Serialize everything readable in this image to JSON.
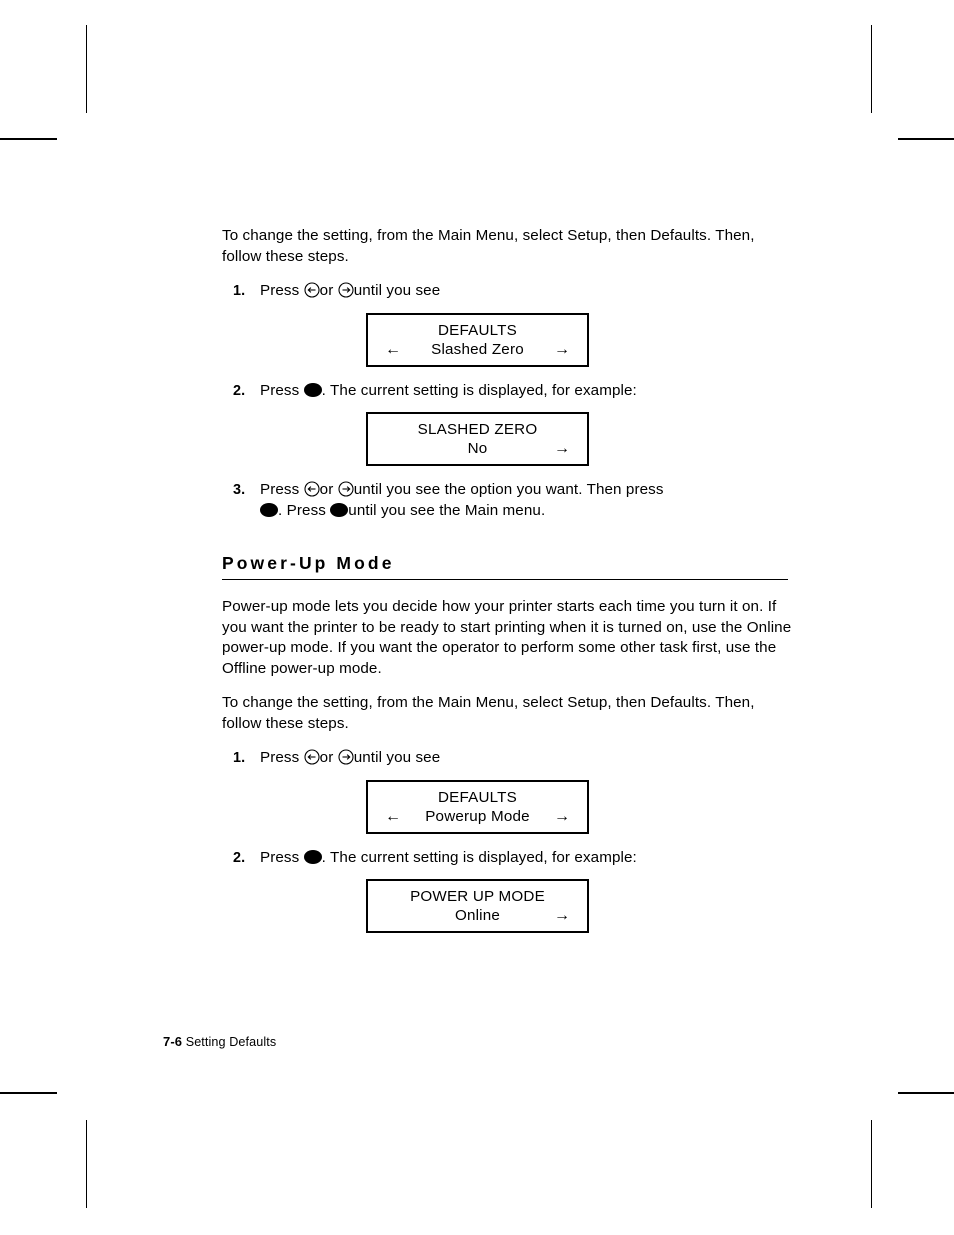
{
  "page": {
    "footer_page_number": "7-6",
    "footer_section": "Setting Defaults"
  },
  "intro_section": {
    "intro_paragraph": "To change the setting, from the Main Menu, select Setup, then Defaults.  Then, follow these steps.",
    "steps": [
      {
        "number": "1.",
        "text_before": "Press",
        "icon_left": "left-arrow-button-icon",
        "text_middle": "or",
        "icon_right": "right-arrow-button-icon",
        "text_after": "until you see"
      },
      {
        "number": "2.",
        "text_before": "Press",
        "icon_enter": "enter-button-icon",
        "text_after": ".  The current setting is displayed, for example:"
      },
      {
        "number": "3.",
        "text_before": "Press",
        "icon_left": "left-arrow-button-icon",
        "text_middle": "or",
        "icon_right": "right-arrow-button-icon",
        "text_after": "until you see the option you want.  Then press",
        "line2_icon_a": "enter-button-icon",
        "line2_text_a": ".  Press",
        "line2_icon_b": "enter-button-icon",
        "line2_text_b": "until you see the Main menu."
      }
    ],
    "lcd_menu": {
      "line1": "DEFAULTS",
      "line2": "Slashed Zero",
      "arrow_left": "←",
      "arrow_right": "→",
      "show_left_arrow": true,
      "show_right_arrow": true
    },
    "lcd_setting": {
      "line1": "SLASHED ZERO",
      "line2": "No",
      "arrow_left": "←",
      "arrow_right": "→",
      "show_left_arrow": false,
      "show_right_arrow": true
    }
  },
  "powerup_section": {
    "heading": "Power-Up Mode",
    "description": "Power-up mode lets you decide how your printer starts each time you turn it on.  If you want the printer to be ready to start printing when it is turned on, use the Online power-up mode.  If you want the operator to perform some other task first, use the Offline power-up mode.",
    "intro_paragraph": "To change the setting, from the Main Menu, select Setup, then Defaults.  Then, follow these steps.",
    "steps": [
      {
        "number": "1.",
        "text_before": "Press",
        "icon_left": "left-arrow-button-icon",
        "text_middle": "or",
        "icon_right": "right-arrow-button-icon",
        "text_after": "until you see"
      },
      {
        "number": "2.",
        "text_before": "Press",
        "icon_enter": "enter-button-icon",
        "text_after": ".  The current setting is displayed, for example:"
      }
    ],
    "lcd_menu": {
      "line1": "DEFAULTS",
      "line2": "Powerup Mode",
      "arrow_left": "←",
      "arrow_right": "→",
      "show_left_arrow": true,
      "show_right_arrow": true
    },
    "lcd_setting": {
      "line1": "POWER UP MODE",
      "line2": "Online",
      "arrow_left": "←",
      "arrow_right": "→",
      "show_left_arrow": false,
      "show_right_arrow": true
    }
  },
  "colors": {
    "text": "#000000",
    "background": "#ffffff",
    "rule": "#000000"
  }
}
